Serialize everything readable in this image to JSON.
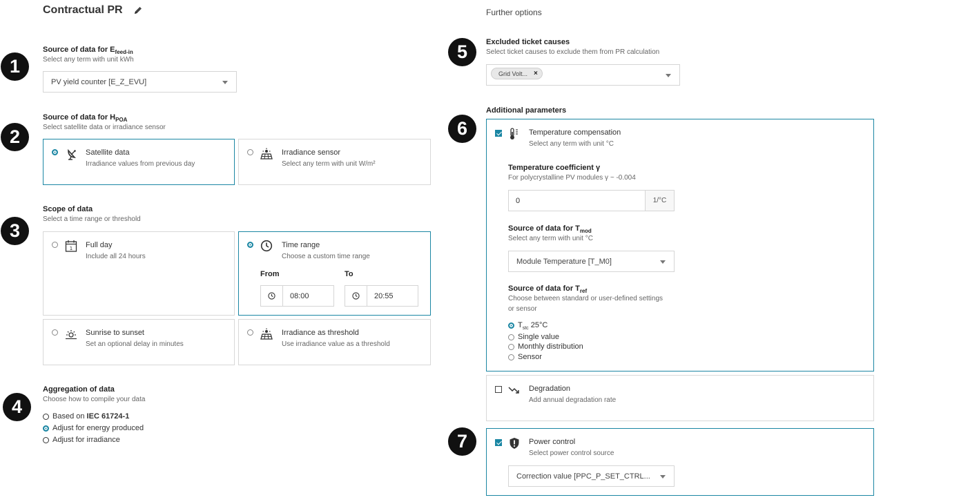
{
  "header": {
    "title": "Contractual PR",
    "further_options": "Further options"
  },
  "badges": [
    "1",
    "2",
    "3",
    "4",
    "5",
    "6",
    "7"
  ],
  "feedin": {
    "label_main": "Source of data for E",
    "label_sub": "feed-in",
    "hint": "Select any term with unit kWh",
    "value": "PV yield counter [E_Z_EVU]"
  },
  "hpoa": {
    "label_main": "Source of data for H",
    "label_sub": "POA",
    "hint": "Select satellite data or irradiance sensor",
    "options": [
      {
        "title": "Satellite data",
        "desc": "Irradiance values from previous day"
      },
      {
        "title": "Irradiance sensor",
        "desc": "Select any term with unit W/m²"
      }
    ]
  },
  "scope": {
    "label": "Scope of data",
    "hint": "Select a time range or threshold",
    "options": [
      {
        "title": "Full day",
        "desc": "Include all 24 hours"
      },
      {
        "title": "Time range",
        "desc": "Choose a custom time range"
      },
      {
        "title": "Sunrise to sunset",
        "desc": "Set an optional delay in minutes"
      },
      {
        "title": "Irradiance as threshold",
        "desc": "Use irradiance value as a threshold"
      }
    ],
    "from_label": "From",
    "to_label": "To",
    "from_value": "08:00",
    "to_value": "20:55",
    "calendar_day": "1"
  },
  "aggregation": {
    "label": "Aggregation of data",
    "hint": "Choose how to compile your data",
    "opt1_prefix": "Based on ",
    "opt1_bold": "IEC 61724-1",
    "opt2": "Adjust for energy produced",
    "opt3": "Adjust for irradiance"
  },
  "excluded": {
    "label": "Excluded ticket causes",
    "hint": "Select ticket causes to exclude them from PR calculation",
    "chip": "Grid Volt...",
    "chip_remove": "×"
  },
  "additional": {
    "label": "Additional parameters",
    "temp": {
      "title": "Temperature compensation",
      "desc": "Select any term with unit °C",
      "coef_label": "Temperature coefficient γ",
      "coef_hint": "For polycrystalline PV modules γ ~ -0.004",
      "coef_value": "0",
      "coef_unit": "1/°C",
      "tmod_main": "Source of data for T",
      "tmod_sub": "mod",
      "tmod_hint": "Select any term with unit °C",
      "tmod_value": "Module Temperature [T_M0]",
      "tref_main": "Source of data for T",
      "tref_sub": "ref",
      "tref_hint1": "Choose between standard or user-defined settings",
      "tref_hint2": "or sensor",
      "opt1_main": "T",
      "opt1_sub": "stc",
      "opt1_rest": " 25°C",
      "opt2": "Single value",
      "opt3": "Monthly distribution",
      "opt4": "Sensor"
    },
    "degradation": {
      "title": "Degradation",
      "desc": "Add annual degradation rate"
    },
    "power": {
      "title": "Power control",
      "desc": "Select power control source",
      "value": "Correction value [PPC_P_SET_CTRL..."
    }
  },
  "colors": {
    "accent": "#1a86a3",
    "badge": "#111111"
  }
}
